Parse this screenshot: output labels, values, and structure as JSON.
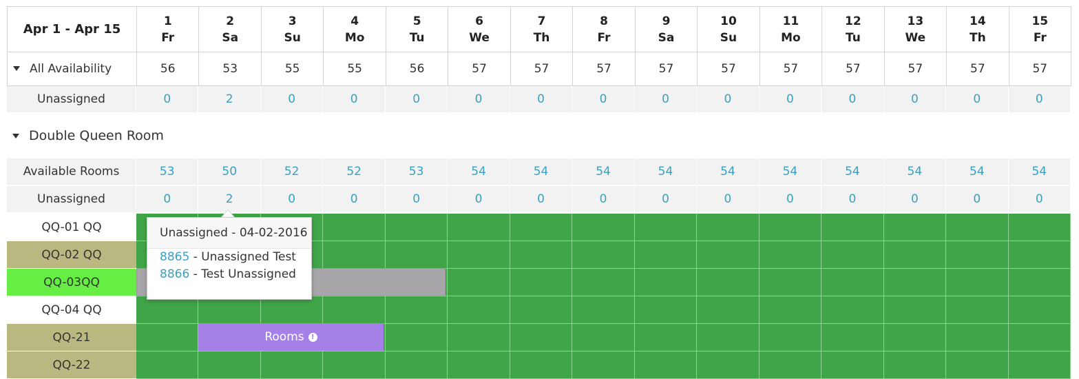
{
  "header": {
    "range": "Apr 1 - Apr 15",
    "days": [
      {
        "num": "1",
        "dow": "Fr"
      },
      {
        "num": "2",
        "dow": "Sa"
      },
      {
        "num": "3",
        "dow": "Su"
      },
      {
        "num": "4",
        "dow": "Mo"
      },
      {
        "num": "5",
        "dow": "Tu"
      },
      {
        "num": "6",
        "dow": "We"
      },
      {
        "num": "7",
        "dow": "Th"
      },
      {
        "num": "8",
        "dow": "Fr"
      },
      {
        "num": "9",
        "dow": "Sa"
      },
      {
        "num": "10",
        "dow": "Su"
      },
      {
        "num": "11",
        "dow": "Mo"
      },
      {
        "num": "12",
        "dow": "Tu"
      },
      {
        "num": "13",
        "dow": "We"
      },
      {
        "num": "14",
        "dow": "Th"
      },
      {
        "num": "15",
        "dow": "Fr"
      }
    ]
  },
  "all_availability": {
    "label": "All Availability",
    "values": [
      "56",
      "53",
      "55",
      "55",
      "56",
      "57",
      "57",
      "57",
      "57",
      "57",
      "57",
      "57",
      "57",
      "57",
      "57"
    ]
  },
  "unassigned_all": {
    "label": "Unassigned",
    "values": [
      "0",
      "2",
      "0",
      "0",
      "0",
      "0",
      "0",
      "0",
      "0",
      "0",
      "0",
      "0",
      "0",
      "0",
      "0"
    ]
  },
  "section": {
    "title": "Double Queen Room",
    "available": {
      "label": "Available Rooms",
      "values": [
        "53",
        "50",
        "52",
        "52",
        "53",
        "54",
        "54",
        "54",
        "54",
        "54",
        "54",
        "54",
        "54",
        "54",
        "54"
      ]
    },
    "unassigned": {
      "label": "Unassigned",
      "values": [
        "0",
        "2",
        "0",
        "0",
        "0",
        "0",
        "0",
        "0",
        "0",
        "0",
        "0",
        "0",
        "0",
        "0",
        "0"
      ]
    },
    "rooms": [
      {
        "name": "QQ-01 QQ",
        "label_color": "#ffffff"
      },
      {
        "name": "QQ-02 QQ",
        "label_color": "#b9b880"
      },
      {
        "name": "QQ-03QQ",
        "label_color": "#66ee44"
      },
      {
        "name": "QQ-04 QQ",
        "label_color": "#ffffff"
      },
      {
        "name": "QQ-21",
        "label_color": "#b9b880"
      },
      {
        "name": "QQ-22",
        "label_color": "#b9b880"
      }
    ]
  },
  "bookings": {
    "purple_label": "Rooms",
    "purple_icon": "exclamation-circle-icon"
  },
  "popover": {
    "title": "Unassigned - 04-02-2016",
    "items": [
      {
        "id": "8865",
        "text": " - Unassigned Test"
      },
      {
        "id": "8866",
        "text": " - Test Unassigned"
      }
    ]
  },
  "colors": {
    "available_green": "#40a548",
    "link_blue": "#3aa0c0",
    "blocked_grey": "#a9a6aa",
    "booking_purple": "#a580e6"
  }
}
